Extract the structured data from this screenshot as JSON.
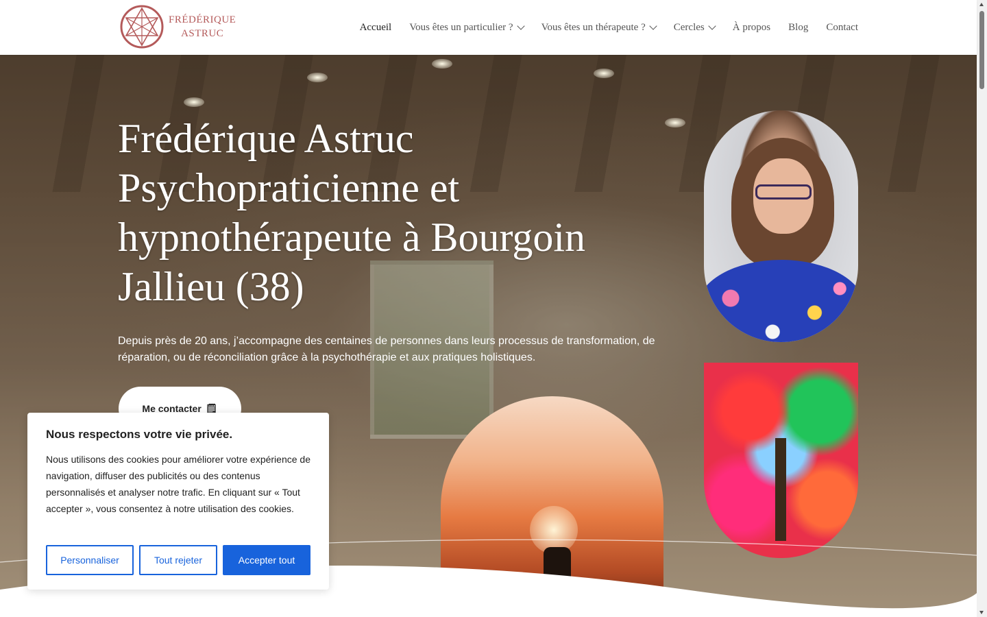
{
  "header": {
    "logo_line1": "FRÉDÉRIQUE",
    "logo_line2": "ASTRUC",
    "logo_color": "#b45a5a",
    "nav": [
      {
        "label": "Accueil",
        "dropdown": false,
        "active": true
      },
      {
        "label": "Vous êtes un particulier ?",
        "dropdown": true
      },
      {
        "label": "Vous êtes un thérapeute ?",
        "dropdown": true
      },
      {
        "label": "Cercles",
        "dropdown": true
      },
      {
        "label": "À propos",
        "dropdown": false
      },
      {
        "label": "Blog",
        "dropdown": false
      },
      {
        "label": "Contact",
        "dropdown": false
      }
    ]
  },
  "hero": {
    "title_line1": "Frédérique Astruc",
    "title_line2": "Psychopraticienne et",
    "title_line3": "hypnothérapeute à Bourgoin",
    "title_line4": "Jallieu (38)",
    "description": "Depuis près de 20 ans, j’accompagne des centaines de personnes dans leurs processus de transformation, de réparation, ou de réconciliation grâce à la psychothérapie et aux pratiques holistiques.",
    "cta_label": "Me contacter",
    "cta_icon": "document-icon"
  },
  "cookie": {
    "title": "Nous respectons votre vie privée.",
    "text": "Nous utilisons des cookies pour améliorer votre expérience de navigation, diffuser des publicités ou des contenus personnalisés et analyser notre trafic. En cliquant sur « Tout accepter », vous consentez à notre utilisation des cookies.",
    "customize": "Personnaliser",
    "reject": "Tout rejeter",
    "accept": "Accepter tout",
    "accent_color": "#1863dc"
  }
}
